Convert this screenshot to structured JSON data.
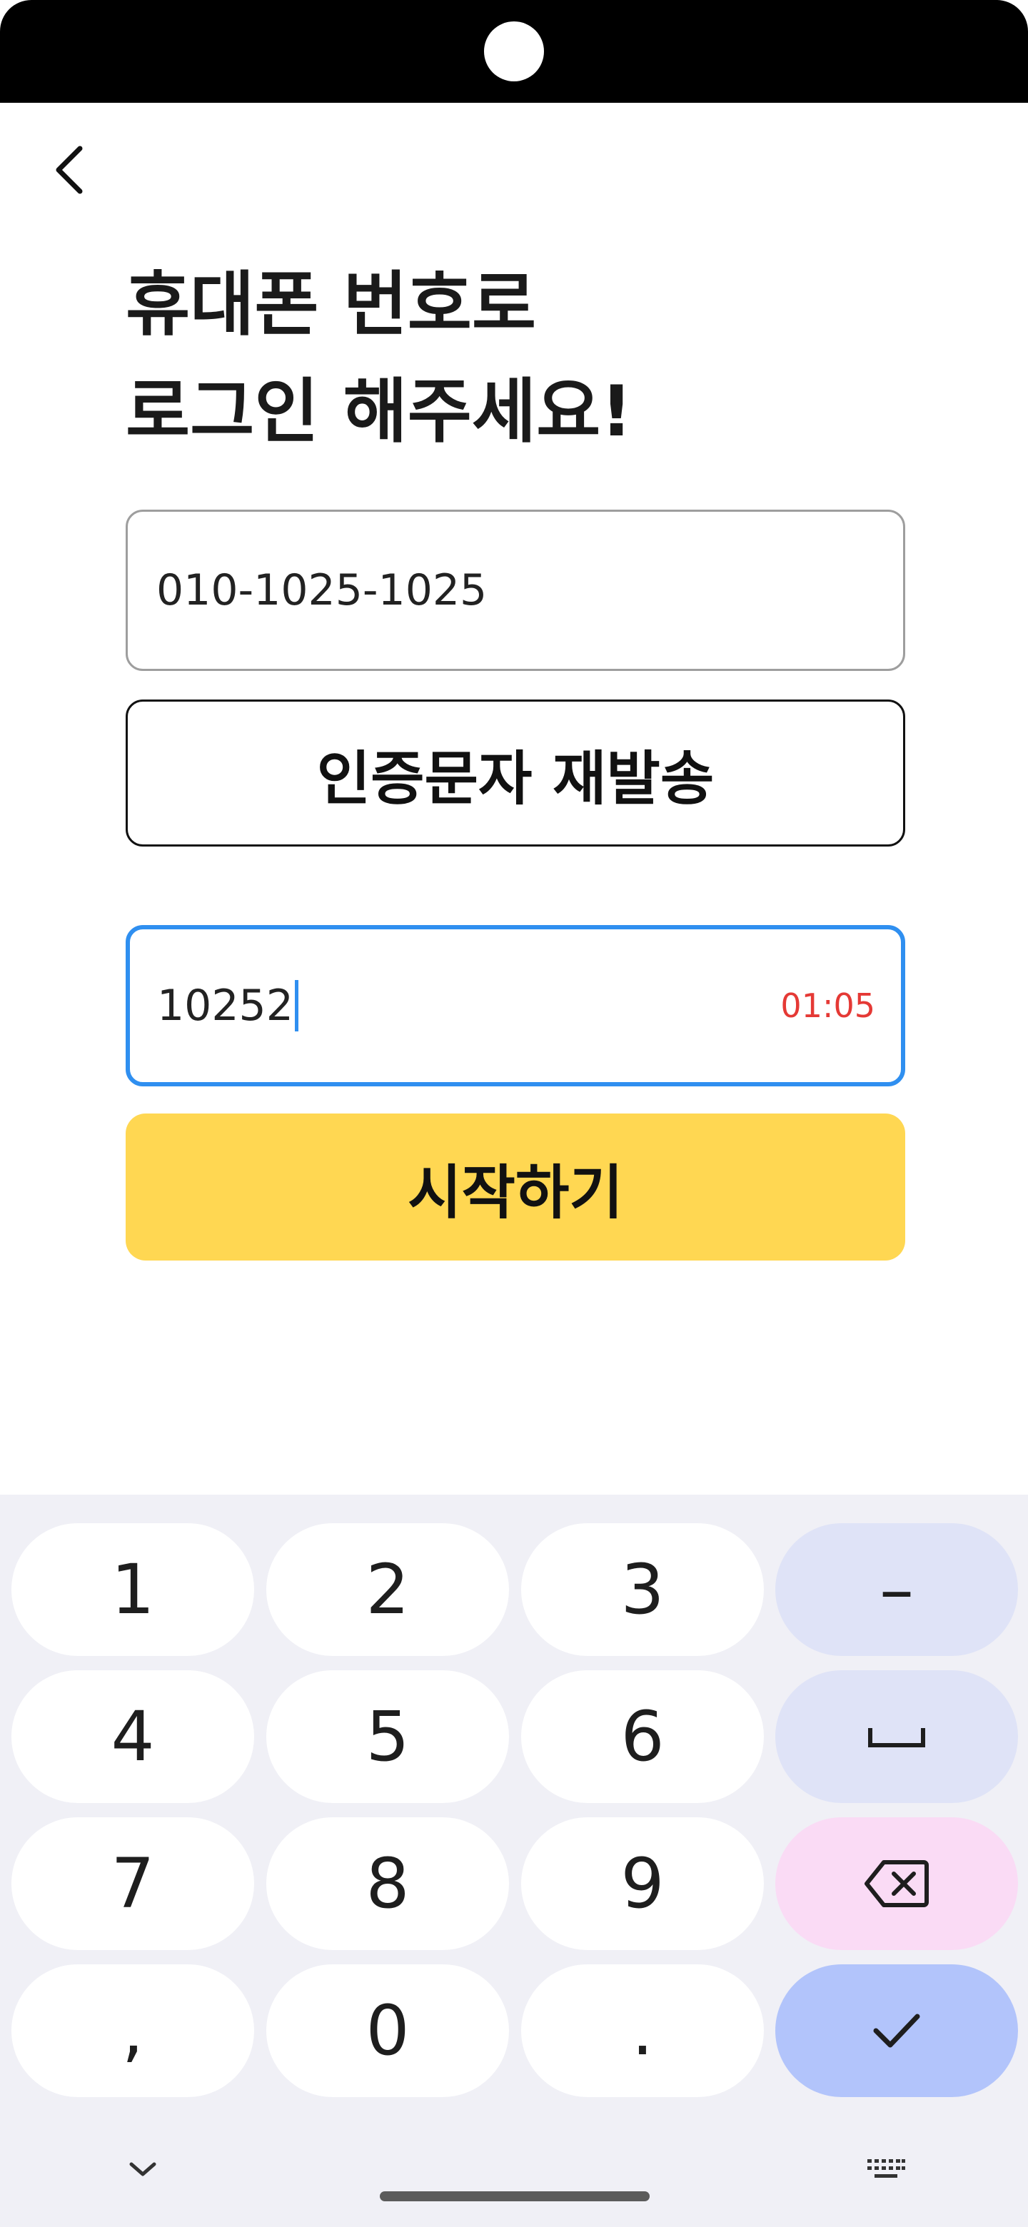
{
  "title": {
    "line1": "휴대폰 번호로",
    "line2": "로그인 해주세요!"
  },
  "phone_field": {
    "value": "010-1025-1025"
  },
  "resend_button": {
    "label": "인증문자 재발송"
  },
  "code_field": {
    "value": "10252",
    "timer": "01:05"
  },
  "start_button": {
    "label": "시작하기"
  },
  "keyboard": {
    "rows": [
      [
        "1",
        "2",
        "3",
        "–"
      ],
      [
        "4",
        "5",
        "6",
        "space-icon"
      ],
      [
        "7",
        "8",
        "9",
        "backspace-icon"
      ],
      [
        ",",
        "0",
        ".",
        "check-icon"
      ]
    ]
  },
  "colors": {
    "accent_blue": "#2f8ff0",
    "start_button_yellow": "#ffd752",
    "timer_red": "#e53935"
  }
}
